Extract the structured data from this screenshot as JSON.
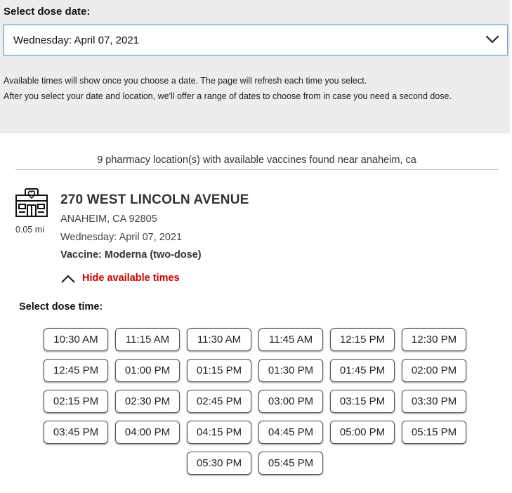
{
  "date_picker": {
    "label": "Select dose date:",
    "selected": "Wednesday: April 07, 2021"
  },
  "info": {
    "line1": "Available times will show once you choose a date. The page will refresh each time you select.",
    "line2": "After you select your date and location, we'll offer a range of dates to choose from in case you need a second dose."
  },
  "results": {
    "count_text": "9 pharmacy location(s) with available vaccines found near anaheim, ca"
  },
  "store": {
    "address": "270 WEST LINCOLN AVENUE",
    "city": "ANAHEIM, CA 92805",
    "date": "Wednesday: April 07, 2021",
    "vaccine": "Vaccine: Moderna (two-dose)",
    "distance": "0.05 mi",
    "hide_times_label": "Hide available times",
    "icon": "pharmacy-store-icon"
  },
  "times": {
    "label": "Select dose time:",
    "slots": [
      "10:30 AM",
      "11:15 AM",
      "11:30 AM",
      "11:45 AM",
      "12:15 PM",
      "12:30 PM",
      "12:45 PM",
      "01:00 PM",
      "01:15 PM",
      "01:30 PM",
      "01:45 PM",
      "02:00 PM",
      "02:15 PM",
      "02:30 PM",
      "02:45 PM",
      "03:00 PM",
      "03:15 PM",
      "03:30 PM",
      "03:45 PM",
      "04:00 PM",
      "04:15 PM",
      "04:45 PM",
      "05:00 PM",
      "05:15 PM",
      "05:30 PM",
      "05:45 PM"
    ]
  },
  "colors": {
    "panel_bg": "#ededed",
    "accent_red": "#cc0000",
    "focus_blue": "#6aa9e0"
  }
}
